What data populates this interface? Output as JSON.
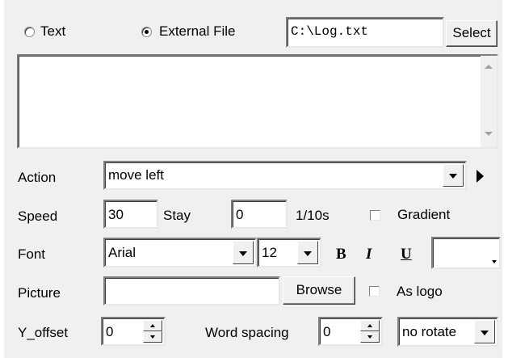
{
  "source": {
    "options": [
      {
        "label": "Text",
        "selected": false
      },
      {
        "label": "External File",
        "selected": true
      }
    ],
    "file_path": "C:\\Log.txt",
    "select_label": "Select",
    "text_content": ""
  },
  "action": {
    "label": "Action",
    "value": "move left"
  },
  "speed": {
    "label": "Speed",
    "value": "30",
    "stay_label": "Stay",
    "stay_value": "0",
    "unit": "1/10s",
    "gradient_label": "Gradient",
    "gradient_checked": false
  },
  "font": {
    "label": "Font",
    "family": "Arial",
    "size": "12",
    "bold": "B",
    "italic": "I",
    "underline": "U",
    "color": "#ffffff"
  },
  "picture": {
    "label": "Picture",
    "value": "",
    "browse_label": "Browse",
    "as_logo_label": "As logo",
    "as_logo_checked": false
  },
  "yoffset": {
    "label": "Y_offset",
    "value": "0",
    "word_spacing_label": "Word spacing",
    "word_spacing_value": "0",
    "rotate": "no rotate"
  }
}
